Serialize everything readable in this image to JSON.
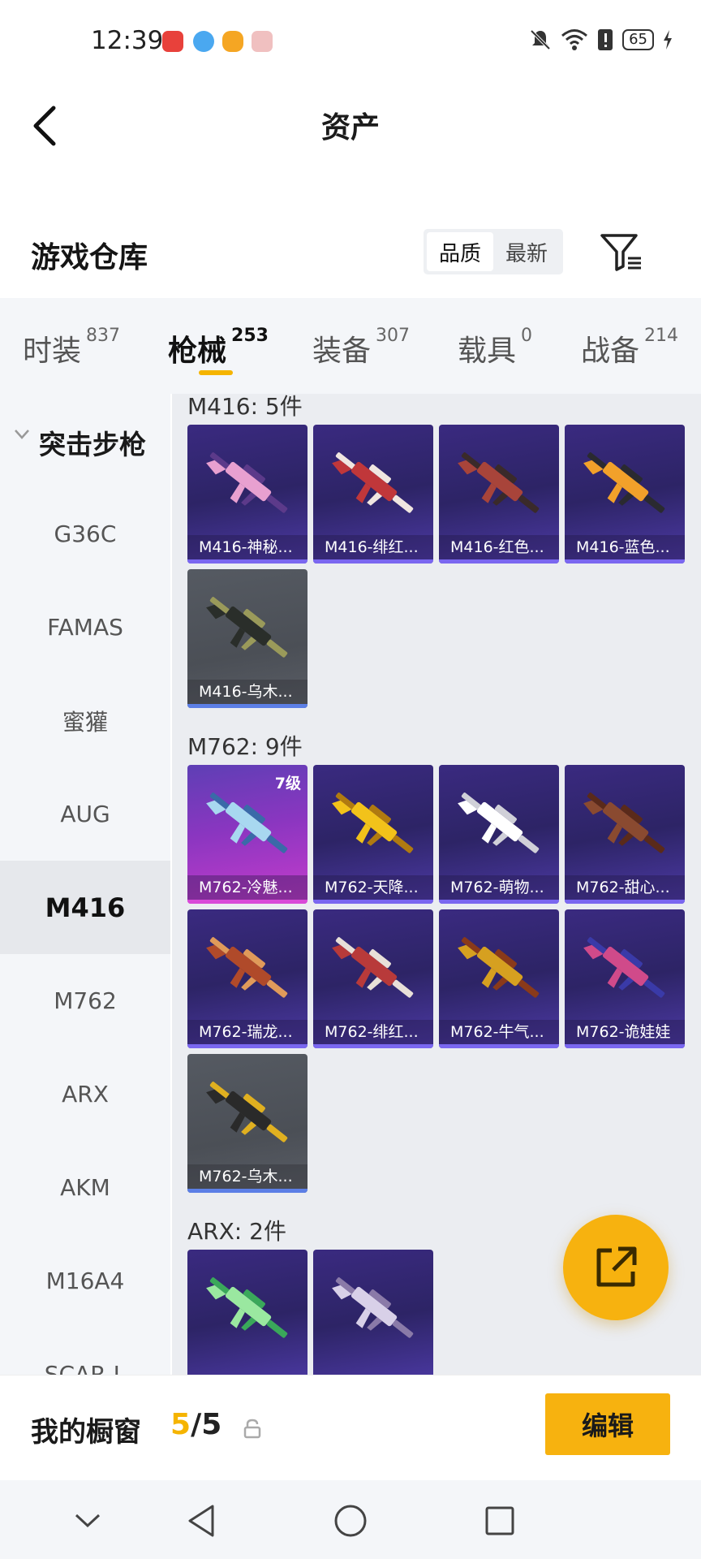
{
  "status_bar": {
    "time": "12:39",
    "battery": "65"
  },
  "header": {
    "title": "资产"
  },
  "section": {
    "title": "游戏仓库",
    "sort_options": [
      "品质",
      "最新"
    ],
    "active_sort": "品质"
  },
  "tabs": [
    {
      "label": "时装",
      "count": "837"
    },
    {
      "label": "枪械",
      "count": "253"
    },
    {
      "label": "装备",
      "count": "307"
    },
    {
      "label": "载具",
      "count": "0"
    },
    {
      "label": "战备",
      "count": "214"
    }
  ],
  "active_tab": "枪械",
  "sidebar": {
    "group_label": "突击步枪",
    "items": [
      "G36C",
      "FAMAS",
      "蜜獾",
      "AUG",
      "M416",
      "M762",
      "ARX",
      "AKM",
      "M16A4",
      "SCAR-L"
    ],
    "active": "M416"
  },
  "groups": [
    {
      "label": "M416: 5件",
      "items": [
        {
          "name": "M416-神秘...",
          "style": "purple",
          "colors": [
            "#e8a0d0",
            "#5c3a8a"
          ]
        },
        {
          "name": "M416-绯红...",
          "style": "purple",
          "colors": [
            "#c0373a",
            "#f0e6e0"
          ]
        },
        {
          "name": "M416-红色...",
          "style": "purple",
          "colors": [
            "#a8443a",
            "#3a2a2a"
          ]
        },
        {
          "name": "M416-蓝色...",
          "style": "purple",
          "colors": [
            "#f2a12a",
            "#2a2a30"
          ]
        },
        {
          "name": "M416-乌木...",
          "style": "gray",
          "colors": [
            "#2a2e2a",
            "#9a9a5a"
          ]
        }
      ]
    },
    {
      "label": "M762: 9件",
      "items": [
        {
          "name": "M762-冷魅...",
          "style": "pink",
          "level": "7级",
          "colors": [
            "#a8d8f0",
            "#3a6aa8"
          ]
        },
        {
          "name": "M762-天降...",
          "style": "purple",
          "colors": [
            "#f2c21a",
            "#b07a10"
          ]
        },
        {
          "name": "M762-萌物...",
          "style": "purple",
          "colors": [
            "#ffffff",
            "#d0d0d8"
          ]
        },
        {
          "name": "M762-甜心...",
          "style": "purple",
          "colors": [
            "#8a4a30",
            "#5a2a1a"
          ]
        },
        {
          "name": "M762-瑞龙...",
          "style": "purple",
          "colors": [
            "#b04a2a",
            "#e09a5a"
          ]
        },
        {
          "name": "M762-绯红...",
          "style": "purple",
          "colors": [
            "#b83a3a",
            "#e8e0d8"
          ]
        },
        {
          "name": "M762-牛气...",
          "style": "purple",
          "colors": [
            "#d6a020",
            "#8a3a1a"
          ]
        },
        {
          "name": "M762-诡娃娃",
          "style": "purple",
          "colors": [
            "#d04a8a",
            "#3a3aa8"
          ]
        },
        {
          "name": "M762-乌木...",
          "style": "gray",
          "colors": [
            "#2a2a2a",
            "#e0b020"
          ]
        }
      ]
    },
    {
      "label": "ARX: 2件",
      "items": [
        {
          "name": "",
          "style": "purple",
          "colors": [
            "#9ae8a0",
            "#3aa85a"
          ]
        },
        {
          "name": "",
          "style": "purple",
          "colors": [
            "#d8d0e8",
            "#8a7aa8"
          ]
        }
      ]
    }
  ],
  "bottom_bar": {
    "label": "我的橱窗",
    "count_current": "5",
    "count_total": "/5",
    "edit_label": "编辑"
  },
  "colors": {
    "accent": "#f7b20f",
    "card_purple": "#2d2466",
    "card_gray": "#4b4f56"
  }
}
